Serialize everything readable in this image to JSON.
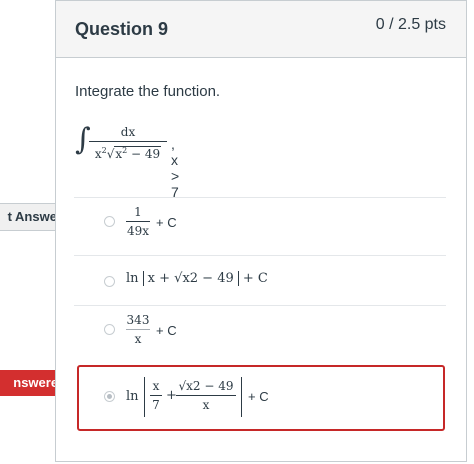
{
  "question": {
    "title": "Question 9",
    "points": "0 / 2.5 pts",
    "prompt": "Integrate the function.",
    "integral": {
      "sign": "∫",
      "numerator": "dx",
      "denominator_prefix": "x2",
      "radicand": "x2 − 49",
      "condition": ", x > 7"
    }
  },
  "flags": {
    "correct_label": "t Answer",
    "selected_label": "nswered"
  },
  "options": [
    {
      "num": "1",
      "den": "49x",
      "suffix": "+ C"
    },
    {
      "prefix": "ln",
      "inner": "x + √x2 − 49",
      "suffix": "+ C"
    },
    {
      "num": "343",
      "den": "x",
      "suffix": "+ C"
    },
    {
      "prefix": "ln",
      "frac1_num": "x",
      "frac1_den": "7",
      "plus": "+",
      "frac2_num": "√x2 − 49",
      "frac2_den": "x",
      "suffix": "+ C"
    }
  ]
}
